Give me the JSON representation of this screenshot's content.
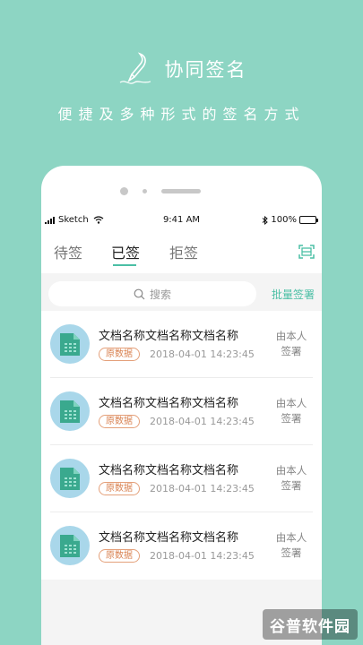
{
  "app": {
    "title": "协同签名",
    "tagline": "便捷及多种形式的签名方式"
  },
  "statusbar": {
    "carrier": "Sketch",
    "time": "9:41 AM",
    "battery": "100%",
    "battery_level": 1.0
  },
  "tabs": [
    {
      "label": "待签",
      "active": false
    },
    {
      "label": "已签",
      "active": true
    },
    {
      "label": "拒签",
      "active": false
    }
  ],
  "search": {
    "placeholder": "搜索"
  },
  "batch_sign_label": "批量签署",
  "documents": [
    {
      "title": "文档名称文档名称文档名称",
      "badge": "原数据",
      "time": "2018-04-01 14:23:45",
      "signer_line1": "由本人",
      "signer_line2": "签署"
    },
    {
      "title": "文档名称文档名称文档名称",
      "badge": "原数据",
      "time": "2018-04-01 14:23:45",
      "signer_line1": "由本人",
      "signer_line2": "签署"
    },
    {
      "title": "文档名称文档名称文档名称",
      "badge": "原数据",
      "time": "2018-04-01 14:23:45",
      "signer_line1": "由本人",
      "signer_line2": "签署"
    },
    {
      "title": "文档名称文档名称文档名称",
      "badge": "原数据",
      "time": "2018-04-01 14:23:45",
      "signer_line1": "由本人",
      "signer_line2": "签署"
    }
  ],
  "watermark": "谷普软件园",
  "colors": {
    "background": "#8dd5c3",
    "accent": "#4bbfa5",
    "badge": "#d98150",
    "doc_icon_bg": "#a9d7ea",
    "doc_icon": "#3aa98e"
  },
  "icons": {
    "logo": "quill-pen-icon",
    "search": "search-icon",
    "scan": "scan-icon",
    "document": "document-icon"
  }
}
